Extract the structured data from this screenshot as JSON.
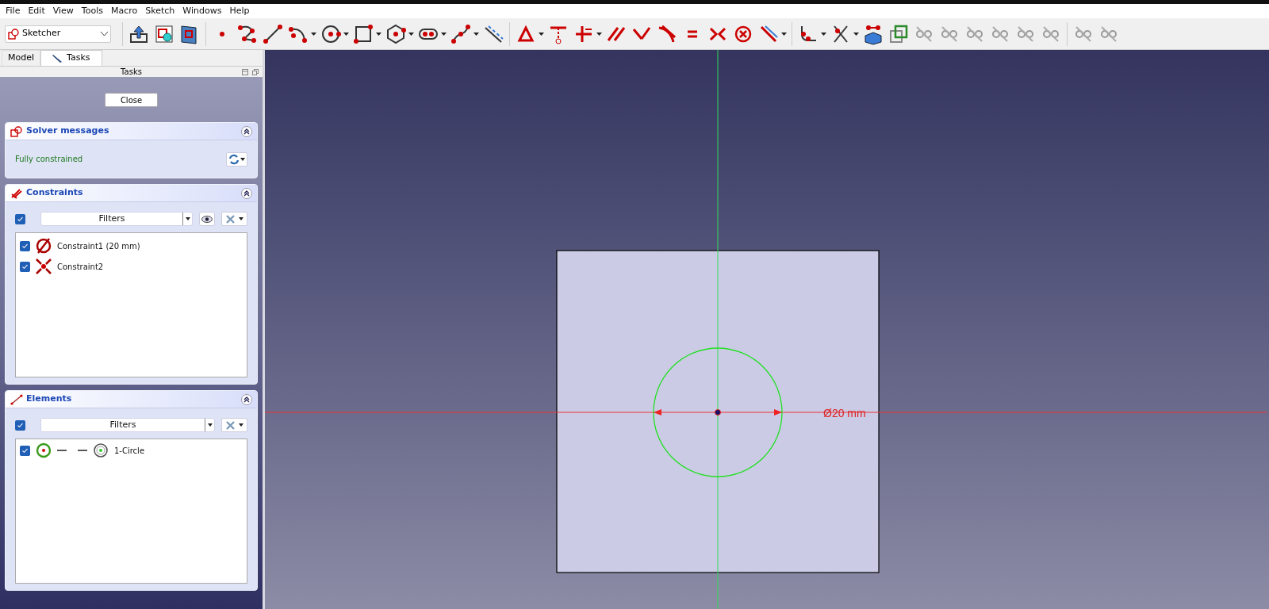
{
  "menu": [
    {
      "label": "File"
    },
    {
      "label": "Edit"
    },
    {
      "label": "View"
    },
    {
      "label": "Tools"
    },
    {
      "label": "Macro"
    },
    {
      "label": "Sketch"
    },
    {
      "label": "Windows"
    },
    {
      "label": "Help"
    }
  ],
  "workbench": {
    "value": "Sketcher"
  },
  "tabs": [
    {
      "label": "Model",
      "selected": false
    },
    {
      "label": "Tasks",
      "selected": true
    }
  ],
  "panel_title": "Tasks",
  "close_button": "Close",
  "solver": {
    "title": "Solver messages",
    "message": "Fully constrained"
  },
  "constraints": {
    "title": "Constraints",
    "filter_checked": true,
    "filter": "Filters",
    "items": [
      {
        "label": "Constraint1 (20 mm)",
        "checked": true,
        "kind": "diameter"
      },
      {
        "label": "Constraint2",
        "checked": true,
        "kind": "coincident"
      }
    ]
  },
  "elements": {
    "title": "Elements",
    "filter_checked": true,
    "filter": "Filters",
    "items": [
      {
        "label": "1-Circle",
        "checked": true
      }
    ]
  },
  "viewport": {
    "dimension": "Ø20 mm"
  }
}
